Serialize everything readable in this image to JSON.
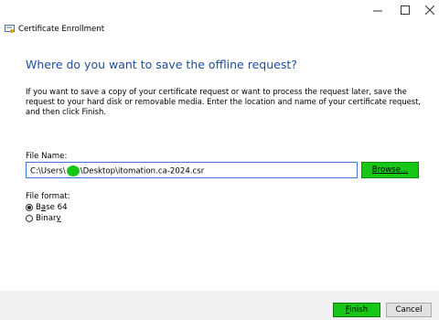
{
  "window": {
    "title": "Certificate Enrollment",
    "icon": "certificate-icon"
  },
  "controls": {
    "minimize": "minimize-icon",
    "maximize": "maximize-icon",
    "close": "close-icon"
  },
  "page": {
    "heading": "Where do you want to save the offline request?",
    "description": "If you want to save a copy of your certificate request or want to process the request later, save the request to your hard disk or removable media. Enter the location and name of your certificate request, and then click Finish."
  },
  "file": {
    "label": "File Name:",
    "value_before": "C:\\Users\\",
    "value_after": "\\Desktop\\itomation.ca-2024.csr",
    "browse_label": "Browse..."
  },
  "format": {
    "label": "File format:",
    "options": [
      {
        "label_u": "a",
        "label_pre": "B",
        "label_post": "se 64",
        "selected": true
      },
      {
        "label_u": "y",
        "label_pre": "Binar",
        "label_post": "",
        "selected": false
      }
    ]
  },
  "footer": {
    "finish_u": "F",
    "finish_rest": "inish",
    "cancel_label": "Cancel"
  },
  "colors": {
    "heading": "#1f4e9c",
    "highlight": "#17c617",
    "input_border": "#3b78d8"
  }
}
